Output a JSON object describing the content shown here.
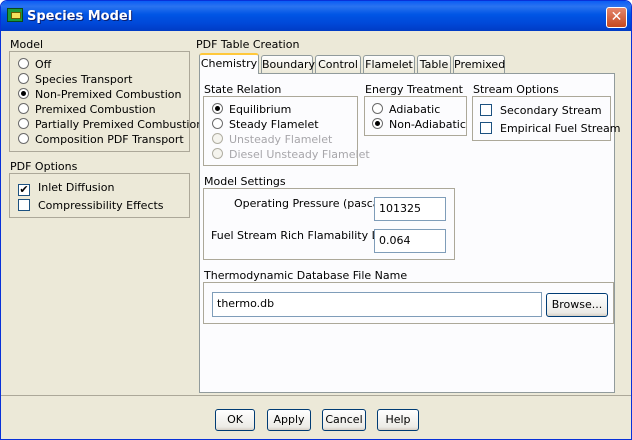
{
  "window": {
    "title": "Species Model",
    "close_glyph": "✕"
  },
  "model": {
    "title": "Model",
    "options": [
      "Off",
      "Species Transport",
      "Non-Premixed Combustion",
      "Premixed Combustion",
      "Partially Premixed Combustion",
      "Composition PDF Transport"
    ],
    "selected": "Non-Premixed Combustion"
  },
  "pdf_options": {
    "title": "PDF Options",
    "items": [
      {
        "label": "Inlet Diffusion",
        "checked": true
      },
      {
        "label": "Compressibility Effects",
        "checked": false
      }
    ]
  },
  "pdf_table": {
    "title": "PDF Table Creation",
    "tabs": [
      "Chemistry",
      "Boundary",
      "Control",
      "Flamelet",
      "Table",
      "Premixed"
    ],
    "active_tab": "Chemistry"
  },
  "state_relation": {
    "title": "State Relation",
    "options": [
      {
        "label": "Equilibrium",
        "selected": true,
        "enabled": true
      },
      {
        "label": "Steady Flamelet",
        "selected": false,
        "enabled": true
      },
      {
        "label": "Unsteady Flamelet",
        "selected": false,
        "enabled": false
      },
      {
        "label": "Diesel Unsteady Flamelet",
        "selected": false,
        "enabled": false
      }
    ]
  },
  "energy_treatment": {
    "title": "Energy Treatment",
    "options": [
      {
        "label": "Adiabatic",
        "selected": false
      },
      {
        "label": "Non-Adiabatic",
        "selected": true
      }
    ]
  },
  "stream_options": {
    "title": "Stream Options",
    "items": [
      {
        "label": "Secondary Stream",
        "checked": false
      },
      {
        "label": "Empirical Fuel Stream",
        "checked": false
      }
    ]
  },
  "model_settings": {
    "title": "Model Settings",
    "operating_pressure_label": "Operating Pressure (pascal)",
    "operating_pressure_value": "101325",
    "rich_limit_label": "Fuel Stream Rich Flamability Limit",
    "rich_limit_value": "0.064"
  },
  "thermo_db": {
    "title": "Thermodynamic Database File Name",
    "value": "thermo.db",
    "browse_label": "Browse..."
  },
  "footer": {
    "ok": "OK",
    "apply": "Apply",
    "cancel": "Cancel",
    "help": "Help"
  },
  "colors": {
    "titlebar": "#0055e5",
    "dialog_bg": "#ece9d8",
    "tab_highlight": "#ffc83c",
    "close_button": "#c5481f"
  }
}
